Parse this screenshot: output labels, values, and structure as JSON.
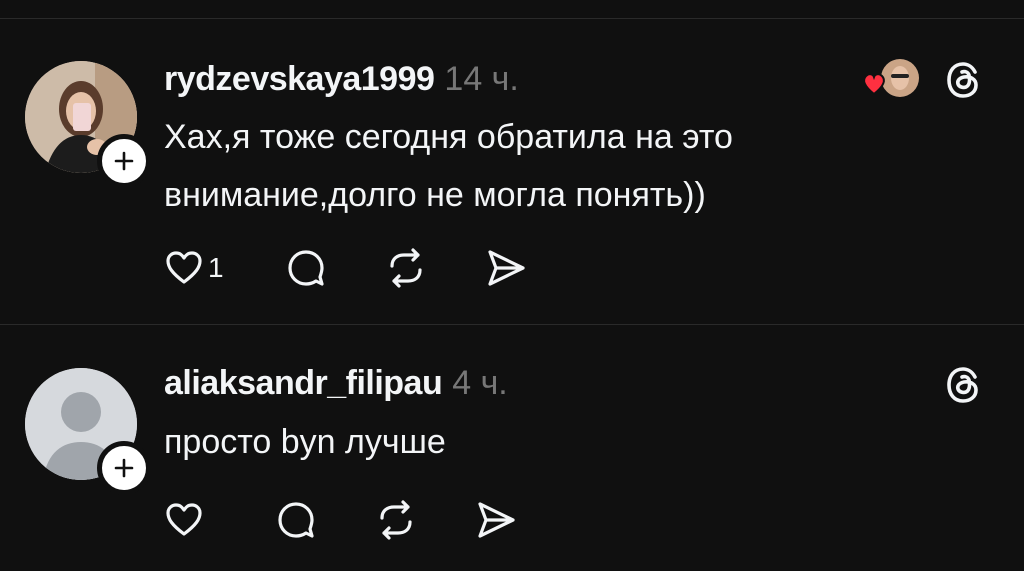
{
  "colors": {
    "background": "#101010",
    "text": "#f3f5f7",
    "muted": "#777777",
    "divider": "#2a2a2a",
    "heart": "#ff3040"
  },
  "posts": [
    {
      "username": "rydzevskaya1999",
      "time": "14 ч.",
      "text_lines": [
        "Хах,я тоже сегодня обратила на это",
        "внимание,долго не могла понять))"
      ],
      "like_count": "1",
      "avatar": "photo",
      "liked_by_author": true
    },
    {
      "username": "aliaksandr_filipau",
      "time": "4 ч.",
      "text_lines": [
        "просто byn лучше"
      ],
      "like_count": "",
      "avatar": "default",
      "liked_by_author": false
    }
  ],
  "icons": {
    "follow": "plus-icon",
    "like": "heart-icon",
    "reply": "speech-bubble-icon",
    "repost": "repost-icon",
    "share": "send-icon",
    "brand": "threads-logo-icon"
  }
}
